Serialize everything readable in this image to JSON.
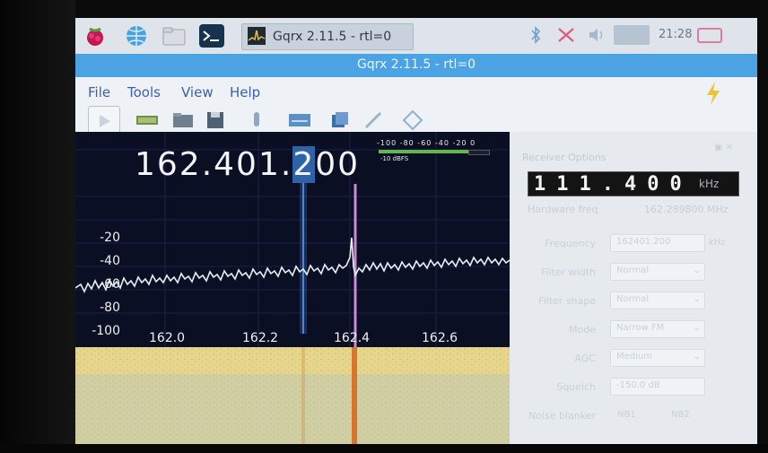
{
  "taskbar": {
    "task_label": "Gqrx 2.11.5 - rtl=0",
    "clock": "21:28",
    "icons": [
      "raspberry-menu-icon",
      "web-browser-icon",
      "file-manager-icon",
      "terminal-icon"
    ],
    "tray_icons": [
      "bluetooth-icon",
      "network-disconnected-icon",
      "volume-icon",
      "cpu-monitor-icon",
      "battery-icon"
    ]
  },
  "window": {
    "title": "Gqrx 2.11.5 - rtl=0"
  },
  "menu": {
    "file": "File",
    "tools": "Tools",
    "view": "View",
    "help": "Help"
  },
  "toolbar": {
    "buttons": [
      "start-dsp-icon",
      "device-settings-icon",
      "open-file-icon",
      "save-icon",
      "record-icon",
      "fft-settings-icon",
      "screenshot-icon",
      "adjust-icon",
      "remote-control-icon"
    ]
  },
  "spectrum": {
    "frequency_prefix": "162.401.",
    "frequency_selected": "2",
    "frequency_suffix": "00",
    "meter_scale": "-100 -80 -60 -40 -20 0",
    "meter_label": "-10 dBFS",
    "y_labels": [
      "-20",
      "-40",
      "-60",
      "-80",
      "-100"
    ],
    "x_labels": [
      "162.0",
      "162.2",
      "162.4",
      "162.6"
    ],
    "colors": {
      "trace": "#e8eef5",
      "tune_marker": "#4f86d9",
      "signal_marker": "#c58bd4",
      "background": "#0b0f24"
    }
  },
  "receiver": {
    "panel_title": "Receiver Options",
    "lcd_value": "111.400",
    "lcd_unit": "kHz",
    "hw_label": "Hardware freq",
    "hw_value": "162.289800 MHz",
    "frequency_label": "Frequency",
    "frequency_value": "162401.200",
    "frequency_unit": "kHz",
    "filter_width_label": "Filter width",
    "filter_width_value": "Normal",
    "filter_shape_label": "Filter shape",
    "filter_shape_value": "Normal",
    "mode_label": "Mode",
    "mode_value": "Narrow FM",
    "agc_label": "AGC",
    "agc_value": "Medium",
    "squelch_label": "Squelch",
    "squelch_value": "-150.0 dB",
    "noise_blanker_label": "Noise blanker",
    "nb1": "NB1",
    "nb2": "NB2"
  }
}
